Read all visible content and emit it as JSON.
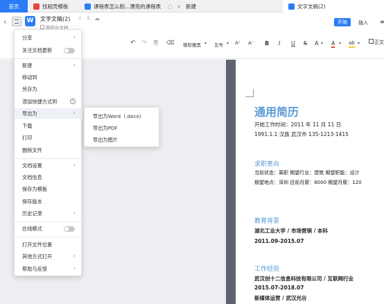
{
  "tabs": [
    {
      "label": "首页"
    },
    {
      "label": "找稻壳模板"
    },
    {
      "label": "课程表怎么制...漂亮的课程表"
    },
    {
      "label": "新建"
    },
    {
      "label": "文字文稿(2)"
    }
  ],
  "header": {
    "doc_title": "文字文稿(2)",
    "cloud_label": "我的云文档",
    "ribbon_tabs": [
      "开始",
      "插入"
    ]
  },
  "format_bar": {
    "font_name": "微软雅黑",
    "font_size": "五号",
    "grow": "A⁺",
    "shrink": "A⁻",
    "bold": "B",
    "italic": "I",
    "underline": "U",
    "strike": "S",
    "superscript": "A",
    "font_color": "A",
    "highlight": "ab",
    "text_body": "正文"
  },
  "menu": {
    "items": [
      {
        "label": "分享",
        "arrow": "›"
      },
      {
        "label": "关注文档更新"
      },
      {
        "label": "新建",
        "arrow": "›"
      },
      {
        "label": "移动到"
      },
      {
        "label": "另存为"
      },
      {
        "label": "添加快捷方式到",
        "info": "i"
      },
      {
        "label": "导出为",
        "arrow": "›"
      },
      {
        "label": "下载"
      },
      {
        "label": "打印"
      },
      {
        "label": "删除文件"
      },
      {
        "label": "文档设置",
        "arrow": "›"
      },
      {
        "label": "文档信息"
      },
      {
        "label": "保存为模板"
      },
      {
        "label": "保存版本"
      },
      {
        "label": "历史记录",
        "arrow": "›"
      },
      {
        "label": "在线模式"
      },
      {
        "label": "打开文件位置"
      },
      {
        "label": "其他方式打开",
        "arrow": "›"
      },
      {
        "label": "帮助与反馈",
        "arrow": "›"
      }
    ],
    "export_submenu": [
      "导出为Word（.docx)",
      "导出为PDF",
      "导出为图片"
    ]
  },
  "resume": {
    "title": "通用简历",
    "work_start": "开始工作时间：2011 年 11 月 11 日",
    "info_line": "1991.1.1      汉族      武汉市      135-1213-1415",
    "sec_intent": "求职意向",
    "intent_1": "当前状态：离职    期望行业：建筑     期望职能：设计",
    "intent_2": "期望地点：深圳    目前月薪：8000   期望月薪：120",
    "sec_edu": "教育背景",
    "edu_1": "湖北工业大学 / 市场营销 / 本科",
    "edu_2": "2011.09-2015.07",
    "sec_work": "工作经验",
    "work_1": "武汉创十二信息科技有限公司 / 互联网行业",
    "work_2": "2015.07-2018.07",
    "work_3": "新媒体运营 / 武汉光谷"
  },
  "colors": {
    "accent": "#2b7cf6",
    "heading": "#5b9bd5"
  }
}
